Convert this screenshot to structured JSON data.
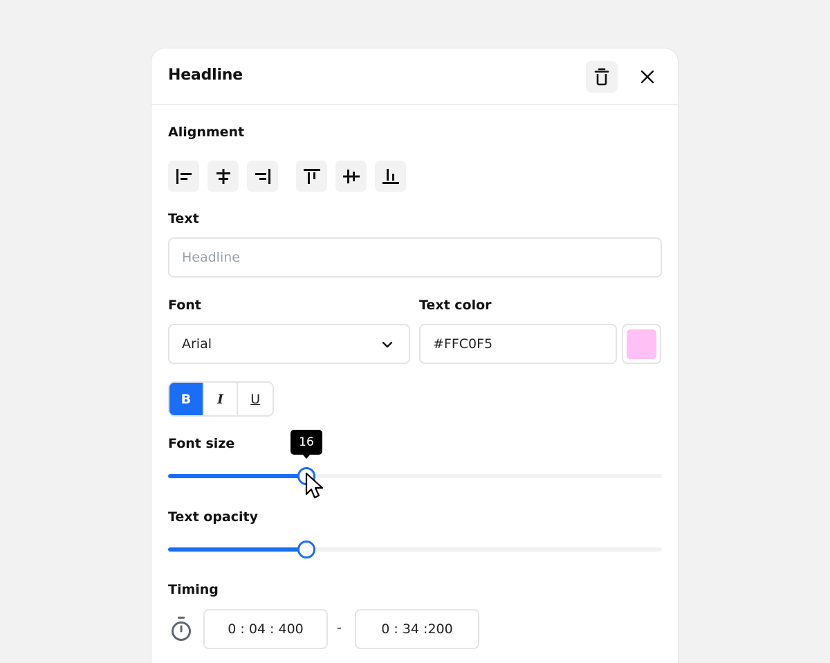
{
  "panel": {
    "title": "Headline"
  },
  "header_icons": {
    "delete": "trash-icon",
    "close": "close-icon"
  },
  "alignment": {
    "label": "Alignment",
    "buttons": [
      {
        "icon": "align-left-icon"
      },
      {
        "icon": "align-center-horizontal-icon"
      },
      {
        "icon": "align-right-icon"
      },
      {
        "icon": "align-top-icon"
      },
      {
        "icon": "align-middle-vertical-icon"
      },
      {
        "icon": "align-bottom-icon"
      }
    ]
  },
  "text": {
    "label": "Text",
    "placeholder": "Headline",
    "value": ""
  },
  "font": {
    "label": "Font",
    "selected": "Arial"
  },
  "text_color": {
    "label": "Text color",
    "value": "#FFC0F5",
    "swatch": "#FFC0F5"
  },
  "format": {
    "bold": "B",
    "italic": "I",
    "underline": "U",
    "active": "bold"
  },
  "font_size": {
    "label": "Font size",
    "tooltip": "16",
    "percent": 28
  },
  "text_opacity": {
    "label": "Text opacity",
    "percent": 28
  },
  "timing": {
    "label": "Timing",
    "start": "0 : 04 : 400",
    "separator": "-",
    "end": "0 : 34 :200"
  },
  "colors": {
    "accent": "#1A6DF5",
    "background": "#F2F2F2"
  }
}
